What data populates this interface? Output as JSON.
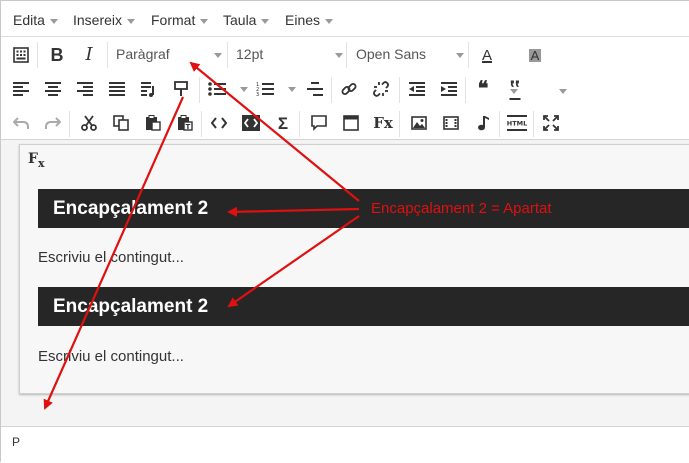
{
  "menubar": {
    "items": [
      {
        "label": "Edita"
      },
      {
        "label": "Insereix"
      },
      {
        "label": "Format"
      },
      {
        "label": "Taula"
      },
      {
        "label": "Eines"
      }
    ]
  },
  "toolbar": {
    "bold": "B",
    "italic": "I",
    "block_format": "Paràgraf",
    "font_size": "12pt",
    "font_family": "Open Sans",
    "text_color": "A",
    "bg_color": "A",
    "blockquote": "❝",
    "cite": "‟",
    "fx": "Fx",
    "html_label": "HTML"
  },
  "content": {
    "fx_label": "F",
    "fx_sub": "x",
    "blocks": [
      {
        "heading": "Encapçalament 2",
        "paragraph": "Escriviu el contingut..."
      },
      {
        "heading": "Encapçalament 2",
        "paragraph": "Escriviu el contingut..."
      }
    ]
  },
  "statusbar": {
    "path": "P"
  },
  "annotation": {
    "text": "Encapçalament 2 = Apartat",
    "color": "#e01010"
  },
  "colors": {
    "heading_bg": "#262626",
    "heading_text": "#ffffff",
    "annotation": "#e01010"
  }
}
